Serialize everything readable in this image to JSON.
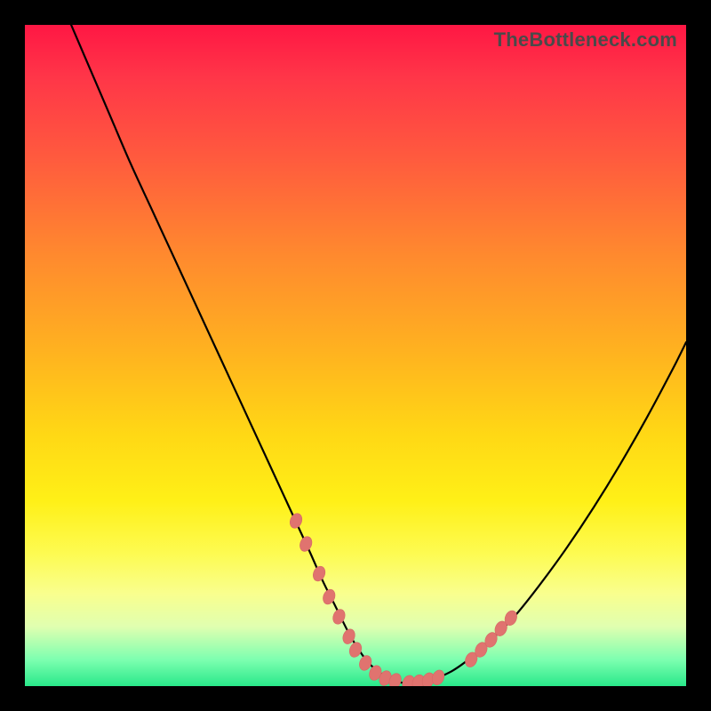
{
  "watermark": "TheBottleneck.com",
  "colors": {
    "frame": "#000000",
    "curve": "#000000",
    "marker_fill": "#e0736f",
    "marker_stroke": "#d56864"
  },
  "chart_data": {
    "type": "line",
    "title": "",
    "xlabel": "",
    "ylabel": "",
    "xlim": [
      0,
      100
    ],
    "ylim": [
      0,
      100
    ],
    "grid": false,
    "legend": false,
    "series": [
      {
        "name": "curve",
        "x": [
          7,
          10,
          13,
          16,
          19,
          22,
          25,
          28,
          31,
          34,
          37,
          40,
          43,
          45,
          47,
          49,
          50.5,
          52,
          54,
          56,
          58,
          60,
          63,
          66,
          70,
          74,
          78,
          82,
          86,
          90,
          94,
          98,
          100
        ],
        "y": [
          100,
          93,
          86,
          79,
          72.5,
          66,
          59.5,
          53,
          46.5,
          40,
          33.5,
          27,
          20.5,
          16,
          12,
          8,
          5.5,
          3.5,
          1.8,
          0.8,
          0.4,
          0.6,
          1.5,
          3.2,
          6.5,
          10.5,
          15.5,
          21,
          27,
          33.5,
          40.5,
          48,
          52
        ]
      }
    ],
    "markers": {
      "name": "highlight-points",
      "points": [
        {
          "x": 41.0,
          "y": 25.0
        },
        {
          "x": 42.5,
          "y": 21.5
        },
        {
          "x": 44.5,
          "y": 17.0
        },
        {
          "x": 46.0,
          "y": 13.5
        },
        {
          "x": 47.5,
          "y": 10.5
        },
        {
          "x": 49.0,
          "y": 7.5
        },
        {
          "x": 50.0,
          "y": 5.5
        },
        {
          "x": 51.5,
          "y": 3.5
        },
        {
          "x": 53.0,
          "y": 2.0
        },
        {
          "x": 54.5,
          "y": 1.2
        },
        {
          "x": 56.0,
          "y": 0.8
        },
        {
          "x": 58.0,
          "y": 0.5
        },
        {
          "x": 59.5,
          "y": 0.6
        },
        {
          "x": 61.0,
          "y": 0.9
        },
        {
          "x": 62.5,
          "y": 1.3
        },
        {
          "x": 67.5,
          "y": 4.0
        },
        {
          "x": 69.0,
          "y": 5.5
        },
        {
          "x": 70.5,
          "y": 7.0
        },
        {
          "x": 72.0,
          "y": 8.7
        },
        {
          "x": 73.5,
          "y": 10.3
        }
      ],
      "size": 7.5
    }
  }
}
